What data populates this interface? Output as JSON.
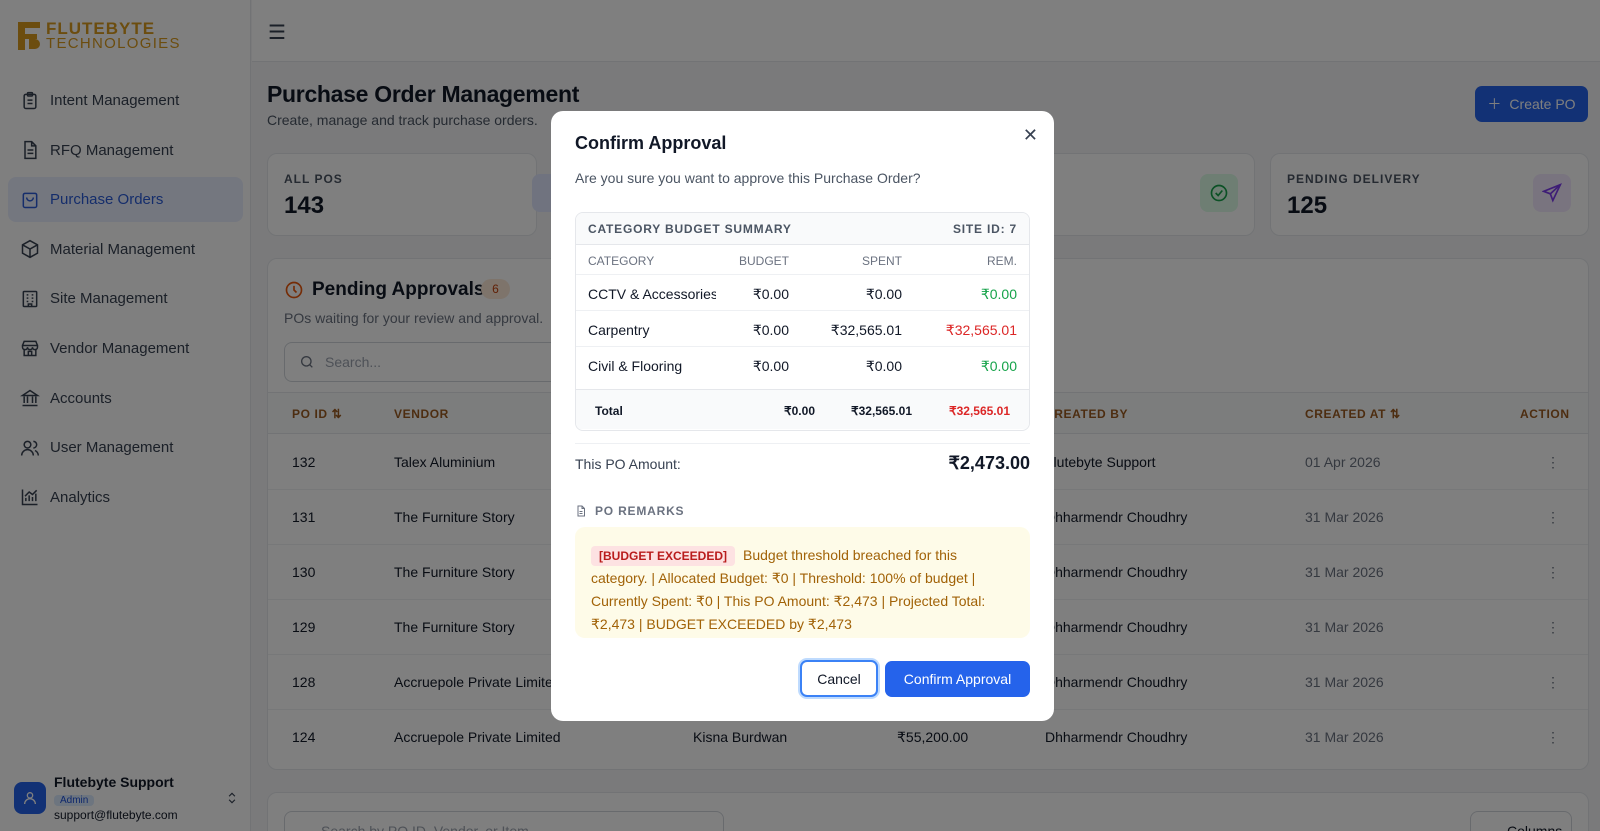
{
  "brand": {
    "line1": "FLUTEBYTE",
    "line2": "TECHNOLOGIES",
    "color": "#d99a1e"
  },
  "sidebar": {
    "items": [
      {
        "label": "Intent Management",
        "icon": "clipboard-icon"
      },
      {
        "label": "RFQ Management",
        "icon": "file-text-icon"
      },
      {
        "label": "Purchase Orders",
        "icon": "shopping-bag-icon",
        "active": true
      },
      {
        "label": "Material Management",
        "icon": "box-icon"
      },
      {
        "label": "Site Management",
        "icon": "building-icon"
      },
      {
        "label": "Vendor Management",
        "icon": "store-icon"
      },
      {
        "label": "Accounts",
        "icon": "bank-icon"
      },
      {
        "label": "User Management",
        "icon": "users-icon"
      },
      {
        "label": "Analytics",
        "icon": "chart-icon"
      }
    ],
    "user": {
      "name": "Flutebyte Support",
      "role": "Admin",
      "email": "support@flutebyte.com"
    }
  },
  "page": {
    "title": "Purchase Order Management",
    "subtitle": "Create, manage and track purchase orders.",
    "create_label": "Create PO"
  },
  "stats": [
    {
      "label": "ALL POS",
      "value": "143"
    },
    {
      "label": "PENDING DELIVERY",
      "value": "125"
    }
  ],
  "pending": {
    "title": "Pending Approvals",
    "count": "6",
    "subtitle": "POs waiting for your review and approval.",
    "search_placeholder": "Search...",
    "columns": {
      "po": "PO ID ⇅",
      "vendor": "VENDOR",
      "created_by": "CREATED BY",
      "created_at": "CREATED AT ⇅",
      "action": "ACTION"
    },
    "rows": [
      {
        "po": "132",
        "vendor": "Talex Aluminium",
        "item": "",
        "amount": "",
        "created_by": "Flutebyte Support",
        "created_at": "01 Apr 2026"
      },
      {
        "po": "131",
        "vendor": "The Furniture Story",
        "item": "",
        "amount": "",
        "created_by": "Dhharmendr Choudhry",
        "created_at": "31 Mar 2026"
      },
      {
        "po": "130",
        "vendor": "The Furniture Story",
        "item": "",
        "amount": "",
        "created_by": "Dhharmendr Choudhry",
        "created_at": "31 Mar 2026"
      },
      {
        "po": "129",
        "vendor": "The Furniture Story",
        "item": "",
        "amount": "",
        "created_by": "Dhharmendr Choudhry",
        "created_at": "31 Mar 2026"
      },
      {
        "po": "128",
        "vendor": "Accruepole Private Limited",
        "item": "",
        "amount": "",
        "created_by": "Dhharmendr Choudhry",
        "created_at": "31 Mar 2026"
      },
      {
        "po": "124",
        "vendor": "Accruepole Private Limited",
        "item": "Kisna Burdwan",
        "amount": "₹55,200.00",
        "created_by": "Dhharmendr Choudhry",
        "created_at": "31 Mar 2026"
      }
    ]
  },
  "bottom": {
    "search_placeholder": "Search by PO ID, Vendor, or Item",
    "columns_label": "Columns"
  },
  "modal": {
    "title": "Confirm Approval",
    "subtitle": "Are you sure you want to approve this Purchase Order?",
    "budget": {
      "heading": "CATEGORY BUDGET SUMMARY",
      "site": "SITE ID: 7",
      "cols": {
        "category": "CATEGORY",
        "budget": "BUDGET",
        "spent": "SPENT",
        "rem": "REM."
      },
      "rows": [
        {
          "category": "CCTV & Accessories",
          "budget": "₹0.00",
          "spent": "₹0.00",
          "rem": "₹0.00",
          "status": "ok"
        },
        {
          "category": "Carpentry",
          "budget": "₹0.00",
          "spent": "₹32,565.01",
          "rem": "₹32,565.01",
          "status": "over"
        },
        {
          "category": "Civil & Flooring",
          "budget": "₹0.00",
          "spent": "₹0.00",
          "rem": "₹0.00",
          "status": "ok"
        }
      ],
      "total": {
        "label": "Total",
        "budget": "₹0.00",
        "spent": "₹32,565.01",
        "rem": "₹32,565.01"
      }
    },
    "po_amount_label": "This PO Amount:",
    "po_amount": "₹2,473.00",
    "remarks_label": "PO REMARKS",
    "remarks_tag": "[BUDGET EXCEEDED]",
    "remarks_text": "Budget threshold breached for this category. | Allocated Budget: ₹0 | Threshold: 100% of budget | Currently Spent: ₹0 | This PO Amount: ₹2,473 | Projected Total: ₹2,473 | BUDGET EXCEEDED by ₹2,473",
    "cancel_label": "Cancel",
    "confirm_label": "Confirm Approval"
  },
  "colors": {
    "accent": "#2563eb",
    "over": "#dc2626",
    "ok": "#16a34a"
  }
}
